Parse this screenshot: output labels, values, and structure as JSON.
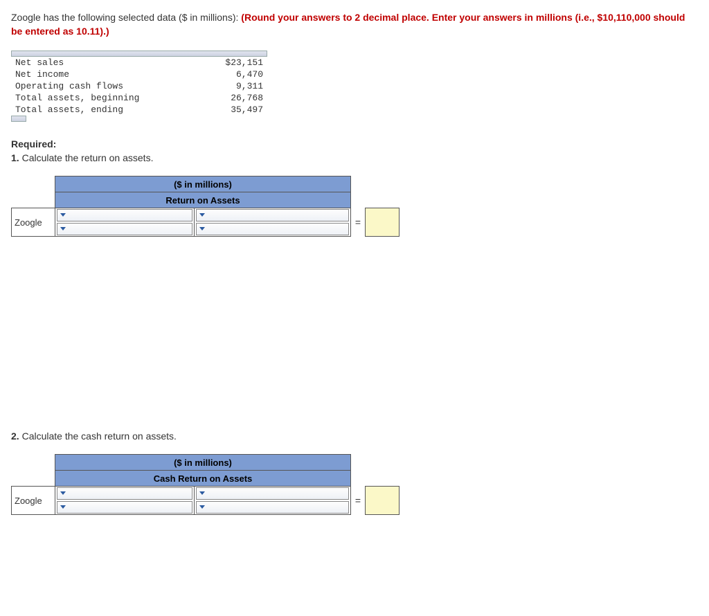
{
  "question": {
    "intro": "Zoogle has the following selected data ($ in millions): ",
    "instruction": "(Round your answers to 2 decimal place. Enter your answers in millions (i.e., $10,110,000 should be entered as 10.11).)"
  },
  "data_rows": [
    {
      "label": "Net sales",
      "value": "$23,151"
    },
    {
      "label": "Net income",
      "value": "6,470"
    },
    {
      "label": "Operating cash flows",
      "value": "9,311"
    },
    {
      "label": "Total assets, beginning",
      "value": "26,768"
    },
    {
      "label": "Total assets, ending",
      "value": "35,497"
    }
  ],
  "required_label": "Required:",
  "q1": {
    "number": "1.",
    "text": "Calculate the return on assets.",
    "header_top": "($ in millions)",
    "header_sub": "Return on Assets",
    "row_label": "Zoogle",
    "equals": "="
  },
  "q2": {
    "number": "2.",
    "text": "Calculate the cash return on assets.",
    "header_top": "($ in millions)",
    "header_sub": "Cash Return on Assets",
    "row_label": "Zoogle",
    "equals": "="
  },
  "chart_data": {
    "type": "table",
    "title": "Zoogle selected data ($ in millions)",
    "rows": [
      {
        "metric": "Net sales",
        "value": 23151
      },
      {
        "metric": "Net income",
        "value": 6470
      },
      {
        "metric": "Operating cash flows",
        "value": 9311
      },
      {
        "metric": "Total assets, beginning",
        "value": 26768
      },
      {
        "metric": "Total assets, ending",
        "value": 35497
      }
    ]
  }
}
